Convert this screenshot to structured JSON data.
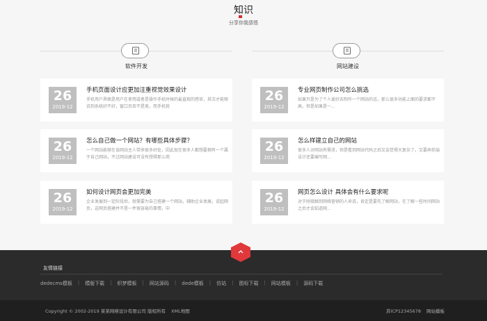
{
  "header": {
    "title": "知识",
    "subtitle": "分享你我感悟"
  },
  "columns": [
    {
      "label": "软件开发",
      "icon": "book-icon"
    },
    {
      "label": "网站建设",
      "icon": "book-icon"
    }
  ],
  "articles": [
    {
      "day": "26",
      "ym": "2019-12",
      "title": "手机页面设计应更加注重视觉效果设计",
      "desc": "手机用户界面是用户在使用或者是操作手机时候的最直观的感官，其次才能够说到系统好不好，窗口页否不是美，而手机就"
    },
    {
      "day": "26",
      "ym": "2019-12",
      "title": "专业网页制作公司怎么挑选",
      "desc": "如果只是为了个人爱好去制作一个网站的话，那么很多功能上面的要求都不高，但是如果是一..."
    },
    {
      "day": "26",
      "ym": "2019-12",
      "title": "怎么自己做一个网站？有哪些具体步骤？",
      "desc": "一个网站能够在该网站主人带来很多好处，因此现在很多人都想要拥有一个属于自己网站，不过网站建设可没有想得那么简"
    },
    {
      "day": "26",
      "ym": "2019-12",
      "title": "怎么样建立自己的网站",
      "desc": "很多人对网站有需求，但是看到网站代码之后又会觉得大复杂了，又要弄前端设计还要编写网..."
    },
    {
      "day": "26",
      "ym": "2019-12",
      "title": "如何设计网页会更加完美",
      "desc": "企业发展到一定阶段后，就需要为自己搭建一个网站，辅助企业发展，说起网页，这网页搭建并不是一件很容易的事情，中"
    },
    {
      "day": "26",
      "ym": "2019-12",
      "title": "网页怎么设计 具体会有什么要求呢",
      "desc": "对于刚接触到网络营销的人来说，肯定是要先了解网站，在了解一些时间网站之后才会知道网..."
    }
  ],
  "footer": {
    "links_title": "友情链接",
    "links": [
      "dedecms模板",
      "模版下载",
      "织梦模板",
      "网站源码",
      "dede模板",
      "仿站",
      "图标下载",
      "网站模板",
      "源码下载"
    ],
    "copyright": "Copyright © 2002-2019 某某网络设计有限公司 版权所有",
    "sitemap": "XML地图",
    "icp": "苏ICP12345678",
    "site_template": "网站模板"
  },
  "colors": {
    "accent": "#e0383b",
    "date_box": "#bfbfbf",
    "footer_bg": "#2b2b2b"
  }
}
